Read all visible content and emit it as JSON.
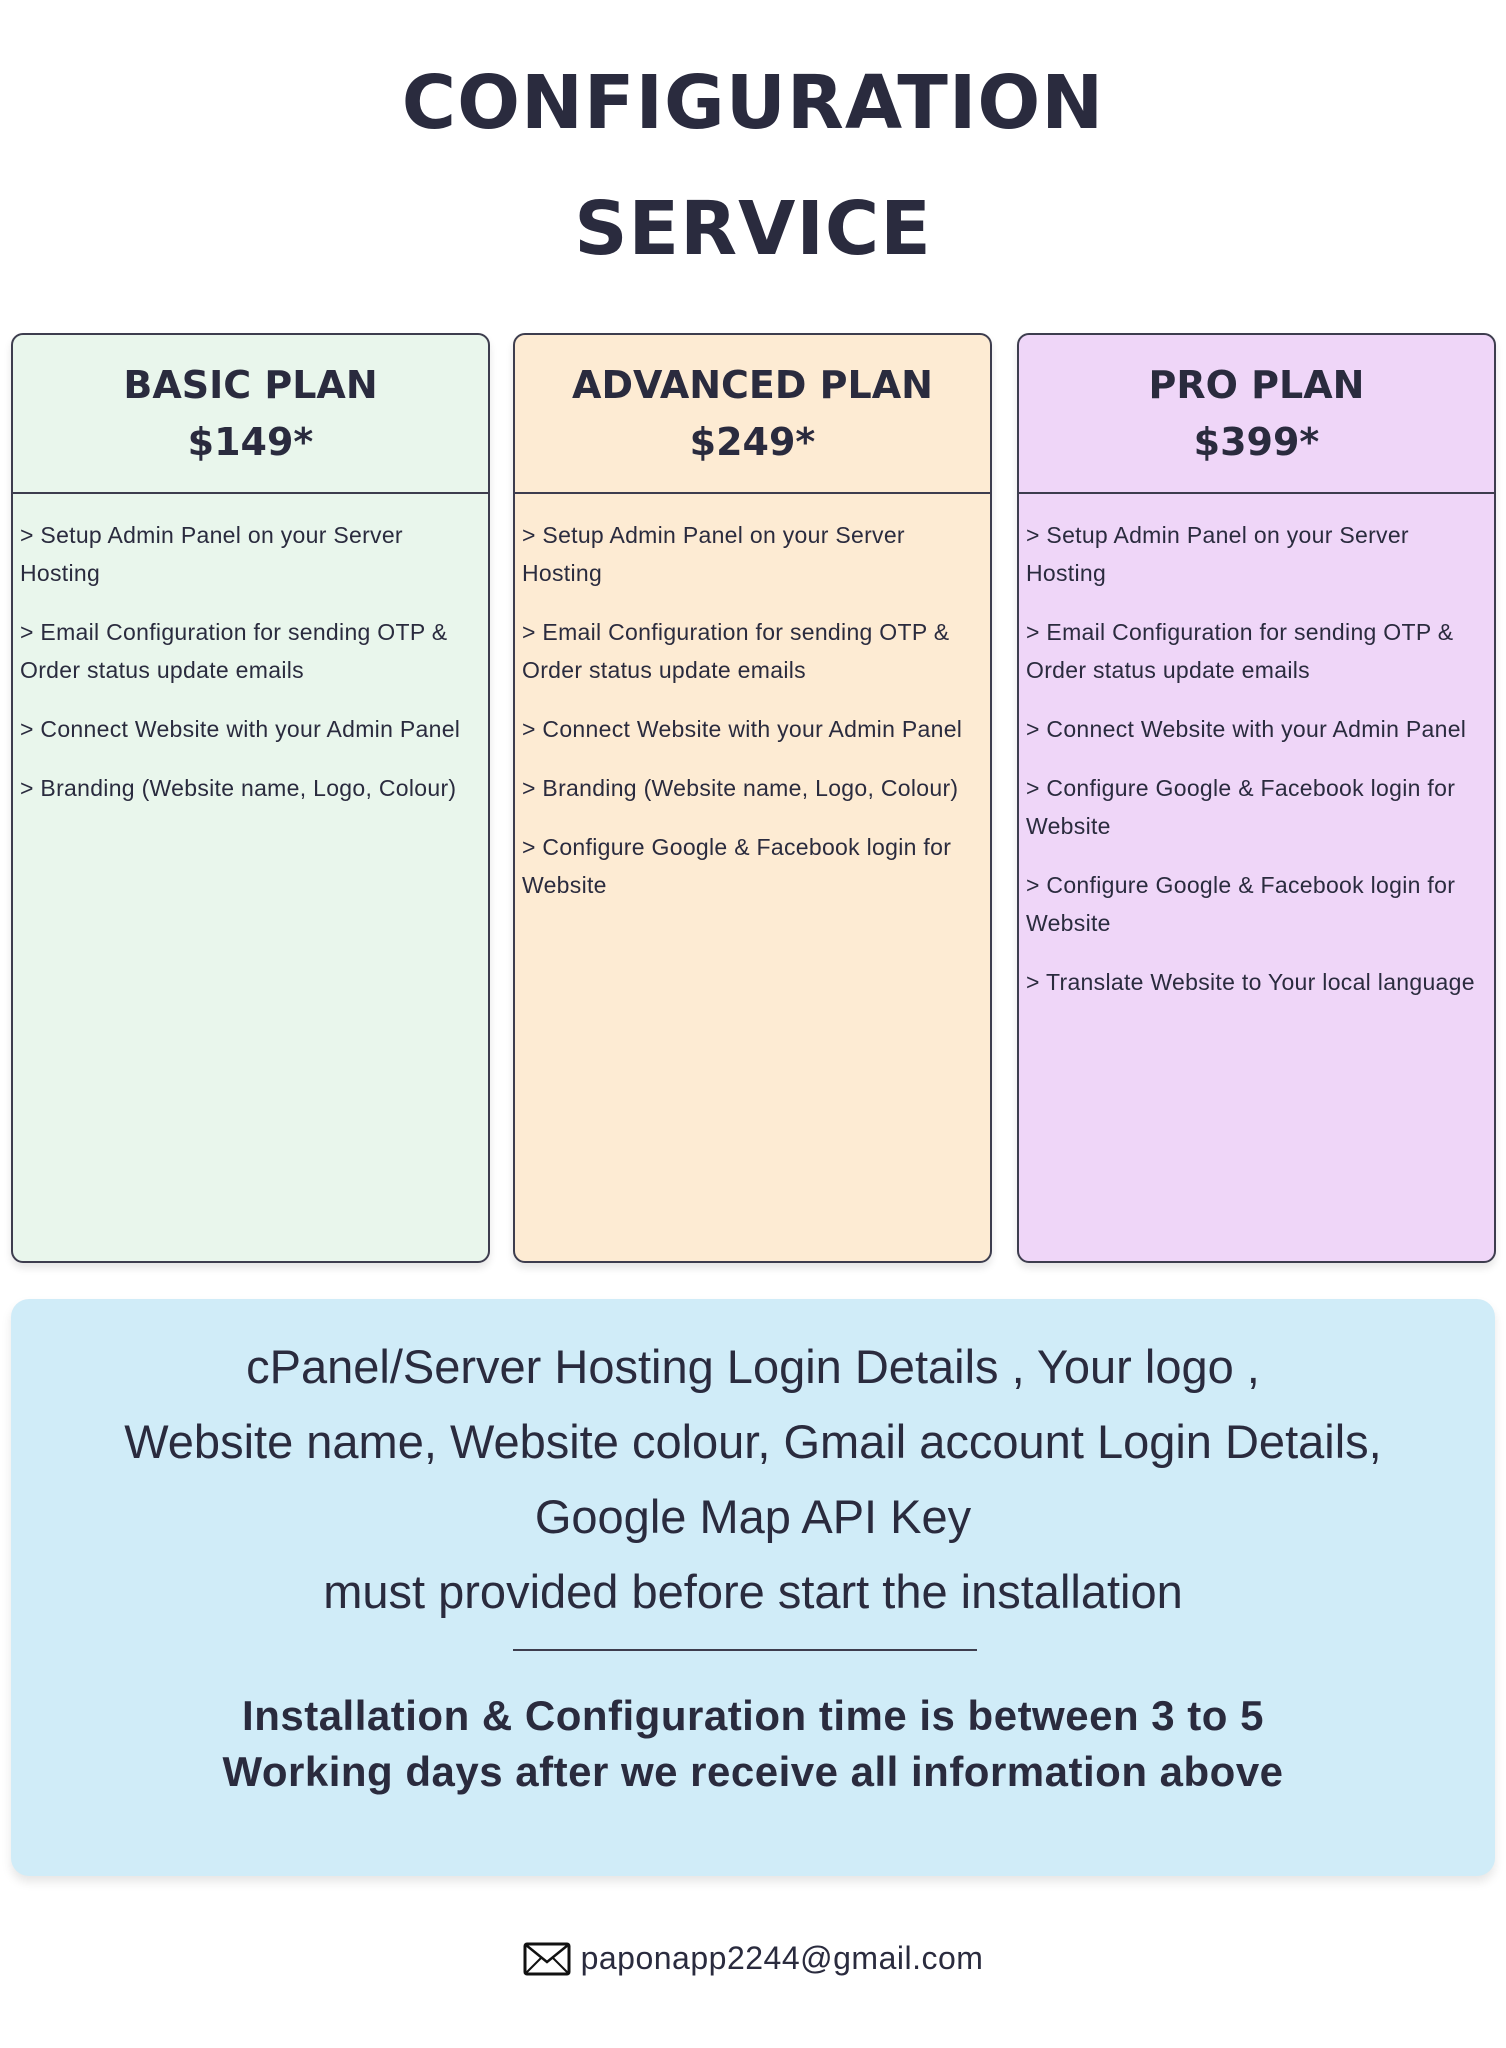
{
  "title": {
    "line1": "CONFIGURATION",
    "line2": "SERVICE"
  },
  "plans": [
    {
      "name": "BASIC PLAN",
      "price": "$149*",
      "background": "#e9f6ec",
      "features": [
        "> Setup Admin Panel on your Server Hosting",
        "> Email Configuration for sending OTP & Order status update emails",
        "> Connect Website with your Admin Panel",
        "> Branding (Website name, Logo, Colour)"
      ]
    },
    {
      "name": "ADVANCED PLAN",
      "price": "$249*",
      "background": "#fdebd3",
      "features": [
        "> Setup Admin Panel on your Server Hosting",
        "> Email Configuration for sending OTP & Order status update emails",
        "> Connect Website with your Admin Panel",
        "> Branding (Website name, Logo, Colour)",
        "> Configure Google & Facebook login for Website"
      ]
    },
    {
      "name": "PRO PLAN",
      "price": "$399*",
      "background": "#efd6f8",
      "features": [
        "> Setup Admin Panel on your Server Hosting",
        "> Email Configuration for sending OTP & Order status update emails",
        "> Connect Website with your Admin Panel",
        "> Configure Google & Facebook login for Website",
        "> Configure Google & Facebook login for Website",
        "> Translate Website to Your local language"
      ]
    }
  ],
  "info": {
    "background": "#d0ecf8",
    "requirements": [
      "cPanel/Server Hosting Login Details , Your logo ,",
      "Website name, Website colour, Gmail account Login Details,",
      "Google Map API Key",
      "must provided before start the installation"
    ],
    "install_time": [
      "Installation & Configuration time is between 3 to 5",
      "Working days after we receive all information above"
    ]
  },
  "contact": {
    "icon": "envelope-icon",
    "email": "paponapp2244@gmail.com"
  },
  "colors": {
    "text": "#2a2b3e",
    "border": "#3d3d4e"
  }
}
